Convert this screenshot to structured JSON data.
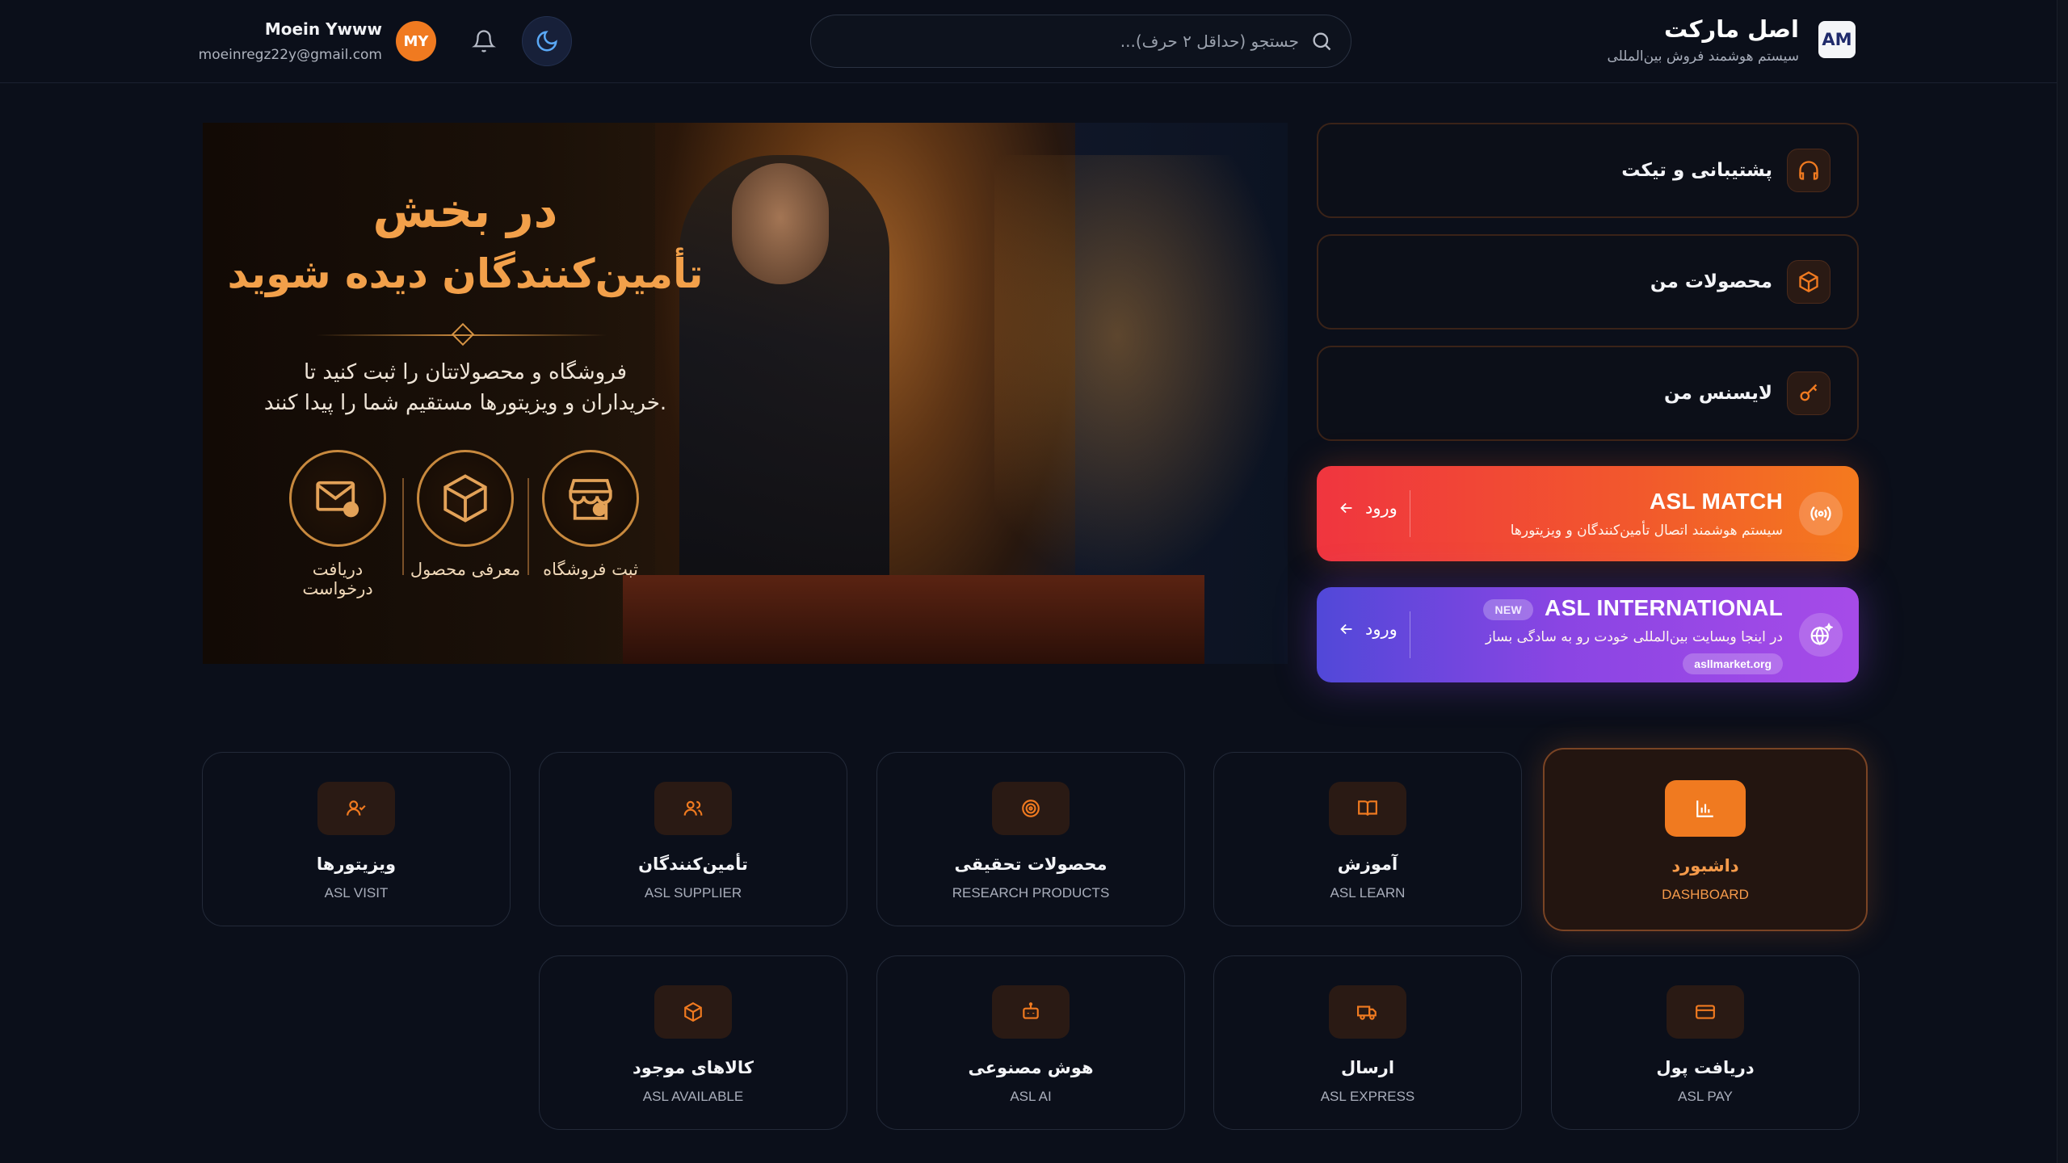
{
  "header": {
    "brand_title": "اصل مارکت",
    "brand_subtitle": "سیستم هوشمند فروش بین‌المللی",
    "logo_text": "AM",
    "search_placeholder": "جستجو (حداقل ۲ حرف)...",
    "user_name": "Moein Ywww",
    "user_email": "moeinregz22y@gmail.com",
    "avatar_initials": "MY"
  },
  "banner": {
    "title_line1": "در بخش",
    "title_line2": "تأمین‌کنندگان دیده شوید",
    "desc_line1": "فروشگاه و محصولاتتان را ثبت کنید تا",
    "desc_line2": "خریداران و ویزیتورها مستقیم شما را پیدا کنند.",
    "features": [
      {
        "label": "ثبت فروشگاه",
        "icon": "store-icon"
      },
      {
        "label": "معرفی محصول",
        "icon": "box-icon"
      },
      {
        "label": "دریافت درخواست",
        "icon": "mail-check-icon"
      }
    ]
  },
  "side_menu": [
    {
      "label": "پشتیبانی و تیکت",
      "icon": "headphones-icon"
    },
    {
      "label": "محصولات من",
      "icon": "package-icon"
    },
    {
      "label": "لایسنس من",
      "icon": "key-icon"
    }
  ],
  "promos": {
    "match": {
      "title": "ASL MATCH",
      "subtitle": "سیستم هوشمند اتصال تأمین‌کنندگان و ویزیتورها",
      "enter_label": "ورود"
    },
    "international": {
      "title": "ASL INTERNATIONAL",
      "badge": "NEW",
      "subtitle": "در اینجا وبسایت بین‌المللی خودت رو به سادگی بساز",
      "url": "asllmarket.org",
      "enter_label": "ورود"
    }
  },
  "tiles_row1": [
    {
      "title": "داشبورد",
      "subtitle": "DASHBOARD",
      "icon": "bar-chart-icon",
      "active": true
    },
    {
      "title": "آموزش",
      "subtitle": "ASL LEARN",
      "icon": "book-icon"
    },
    {
      "title": "محصولات تحقیقی",
      "subtitle": "RESEARCH PRODUCTS",
      "icon": "target-icon"
    },
    {
      "title": "تأمین‌کنندگان",
      "subtitle": "ASL SUPPLIER",
      "icon": "users-icon"
    },
    {
      "title": "ویزیتورها",
      "subtitle": "ASL VISIT",
      "icon": "user-check-icon"
    }
  ],
  "tiles_row2": [
    {
      "title": "دریافت پول",
      "subtitle": "ASL PAY",
      "icon": "credit-card-icon"
    },
    {
      "title": "ارسال",
      "subtitle": "ASL EXPRESS",
      "icon": "truck-icon"
    },
    {
      "title": "هوش مصنوعی",
      "subtitle": "ASL AI",
      "icon": "bot-icon"
    },
    {
      "title": "کالاهای موجود",
      "subtitle": "ASL AVAILABLE",
      "icon": "box-icon"
    }
  ],
  "colors": {
    "background": "#0b0f1a",
    "accent_orange": "#f07a20",
    "match_gradient_start": "#f0353f",
    "intl_gradient_start": "#5148d8",
    "intl_gradient_end": "#a64be8"
  }
}
